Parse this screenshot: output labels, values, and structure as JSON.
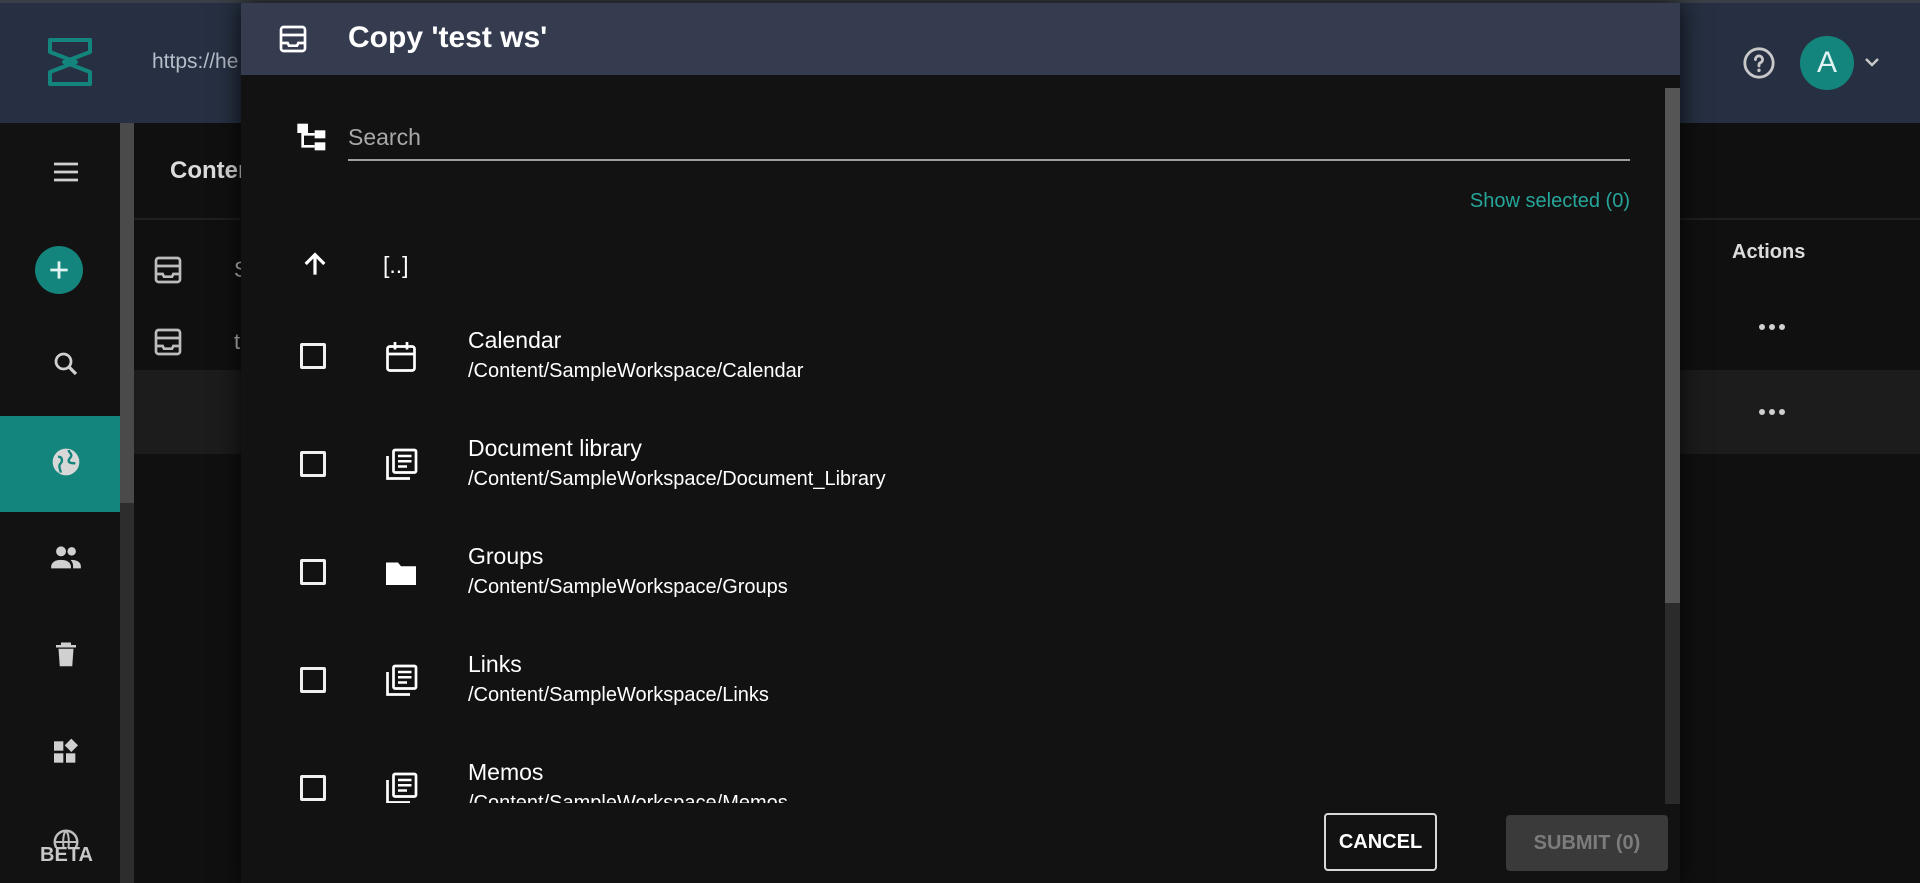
{
  "app": {
    "url_text": "https://he",
    "avatar_letter": "A",
    "breadcrumb_partial": "Conter",
    "actions_header": "Actions",
    "beta_label": "BETA",
    "background_rows": [
      "S",
      "t"
    ]
  },
  "colors": {
    "accent": "#13857c",
    "link": "#26a69a",
    "topbar": "#263042",
    "modal_header": "#363c50"
  },
  "sidebar": {
    "icons": [
      "menu-icon",
      "add-icon",
      "search-icon",
      "globe-icon",
      "users-icon",
      "trash-icon",
      "widgets-icon",
      "localization-icon"
    ]
  },
  "modal": {
    "title": "Copy 'test ws'",
    "search_placeholder": "Search",
    "show_selected": "Show selected (0)",
    "parent_label": "[..]",
    "items": [
      {
        "name": "Calendar",
        "path": "/Content/SampleWorkspace/Calendar",
        "icon": "calendar-icon"
      },
      {
        "name": "Document library",
        "path": "/Content/SampleWorkspace/Document_Library",
        "icon": "library-icon"
      },
      {
        "name": "Groups",
        "path": "/Content/SampleWorkspace/Groups",
        "icon": "folder-icon"
      },
      {
        "name": "Links",
        "path": "/Content/SampleWorkspace/Links",
        "icon": "library-icon"
      },
      {
        "name": "Memos",
        "path": "/Content/SampleWorkspace/Memos",
        "icon": "library-icon"
      }
    ],
    "cancel_label": "CANCEL",
    "submit_label": "SUBMIT (0)"
  }
}
